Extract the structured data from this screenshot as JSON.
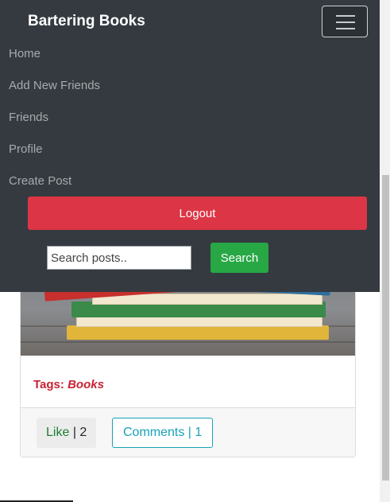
{
  "navbar": {
    "brand": "Bartering Books",
    "items": [
      {
        "label": "Home"
      },
      {
        "label": "Add New Friends"
      },
      {
        "label": "Friends"
      },
      {
        "label": "Profile"
      },
      {
        "label": "Create Post"
      }
    ],
    "logout_label": "Logout",
    "search": {
      "placeholder": "Search posts..",
      "value": "",
      "button_label": "Search"
    }
  },
  "post": {
    "tags_label": "Tags:",
    "tags_value": "Books",
    "like": {
      "label": "Like",
      "separator": "|",
      "count": "2"
    },
    "comments": {
      "label": "Comments | 1"
    }
  },
  "colors": {
    "navbar_bg": "#343a40",
    "logout": "#dc3545",
    "search_button": "#28a745",
    "comments_outline": "#17a2b8",
    "tags": "#c82333"
  }
}
